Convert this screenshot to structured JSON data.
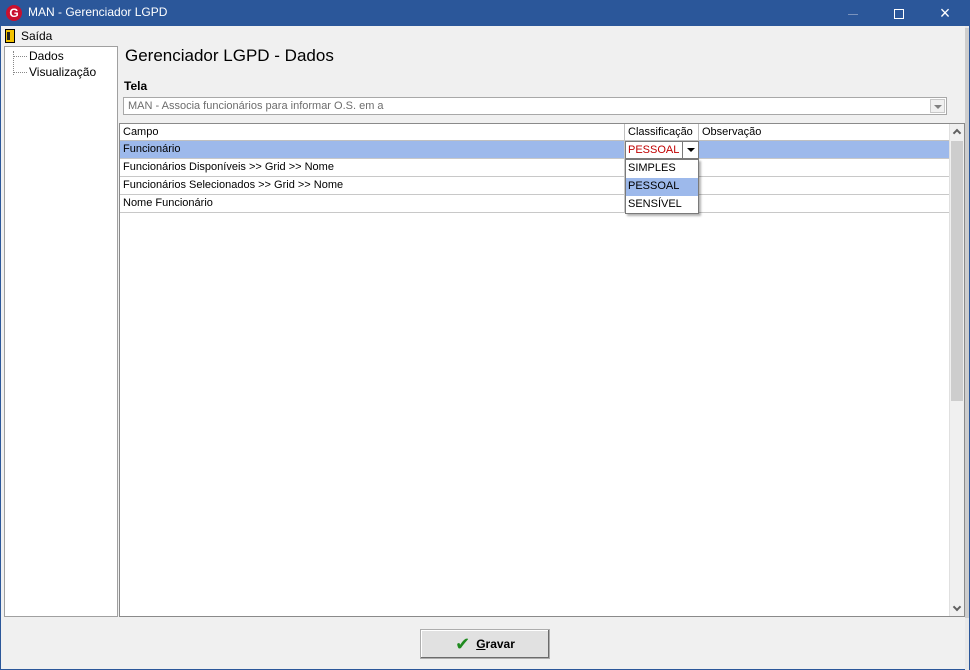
{
  "window": {
    "title": "MAN - Gerenciador LGPD",
    "app_icon": "G",
    "controls": {
      "minimize": "minimize-icon",
      "maximize": "maximize-icon",
      "close": "×"
    }
  },
  "menu": {
    "exit_label": "Saída",
    "exit_icon": "exit-door-icon"
  },
  "tree": {
    "items": [
      {
        "label": "Dados"
      },
      {
        "label": "Visualização"
      }
    ]
  },
  "page_title": "Gerenciador LGPD - Dados",
  "tela": {
    "label": "Tela",
    "value": "MAN - Associa funcionários para informar O.S. em a"
  },
  "grid": {
    "columns": [
      "Campo",
      "Classificação",
      "Observação"
    ],
    "rows": [
      {
        "campo": "Funcionário",
        "classificacao": "PESSOAL",
        "observacao": ""
      },
      {
        "campo": "Funcionários Disponíveis >> Grid >> Nome",
        "classificacao": "",
        "observacao": ""
      },
      {
        "campo": "Funcionários Selecionados >> Grid >> Nome",
        "classificacao": "",
        "observacao": ""
      },
      {
        "campo": "Nome Funcionário",
        "classificacao": "",
        "observacao": ""
      }
    ],
    "editor_value": "PESSOAL",
    "dropdown_options": [
      "SIMPLES",
      "PESSOAL",
      "SENSÍVEL"
    ],
    "dropdown_highlighted": "PESSOAL"
  },
  "colors": {
    "titlebar": "#2b579a",
    "selection": "#9db9eb",
    "editor_text": "#c00000",
    "check": "#1f8a1f"
  },
  "buttons": {
    "save_label_first": "G",
    "save_label_rest": "ravar",
    "save_icon": "checkmark-icon"
  }
}
